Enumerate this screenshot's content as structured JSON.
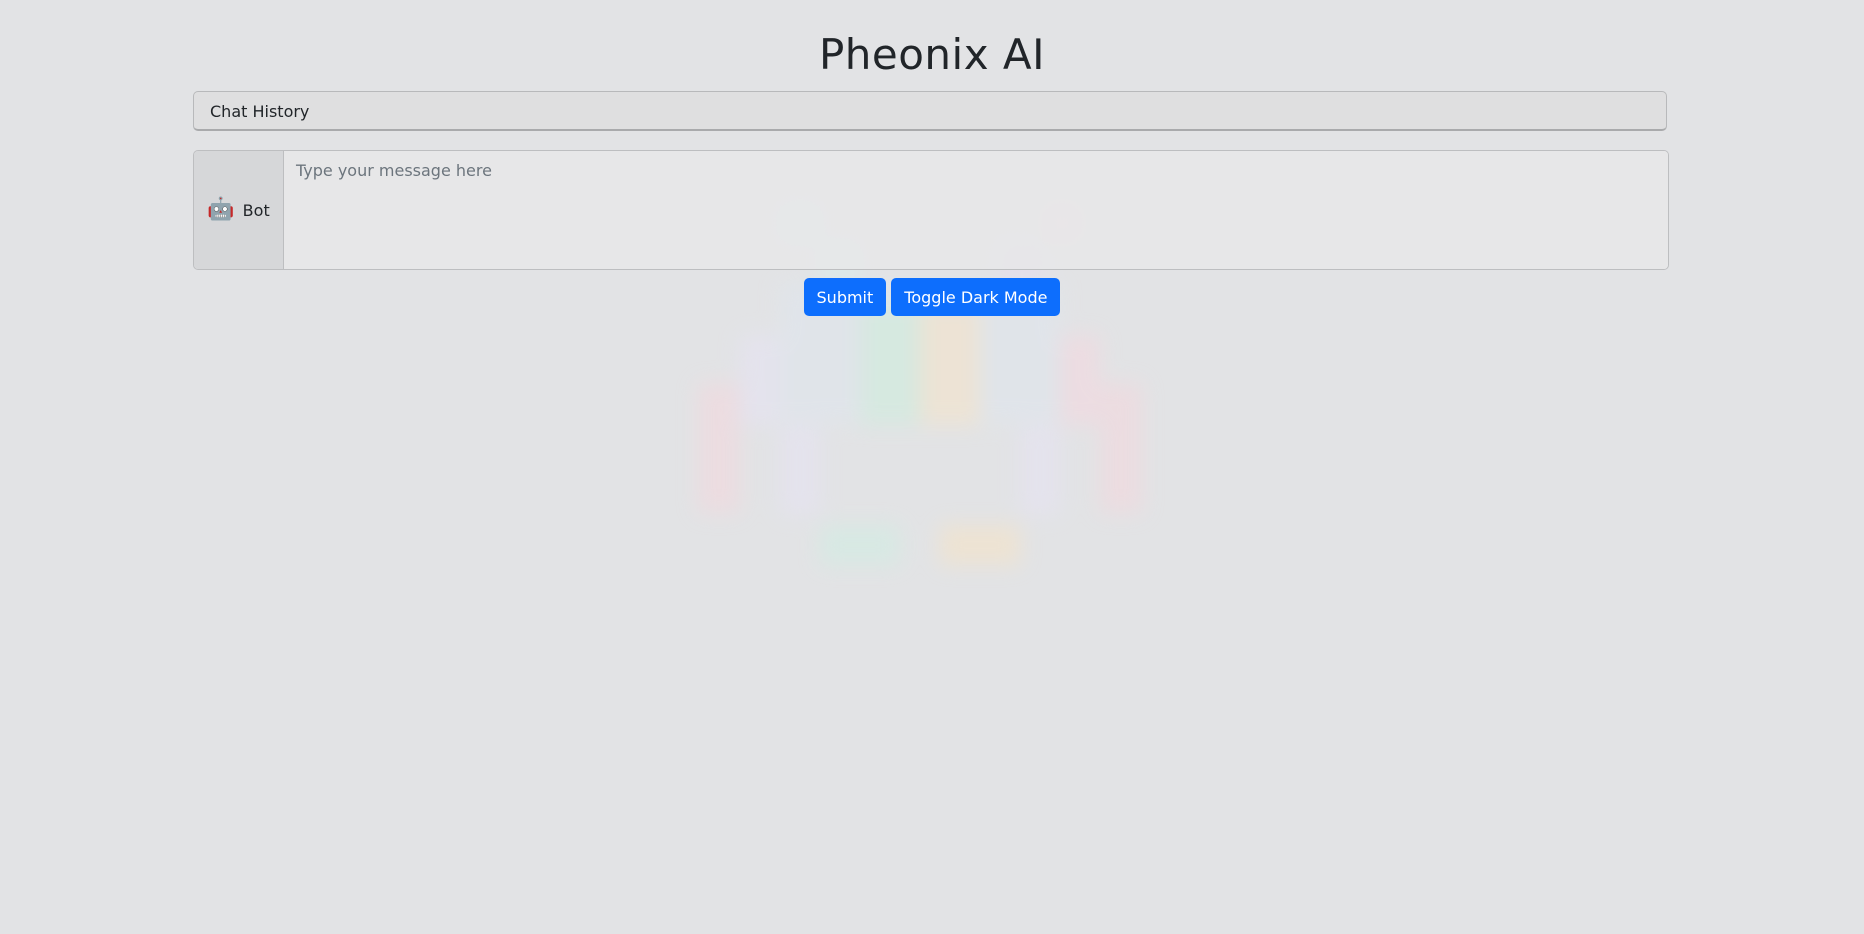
{
  "app": {
    "title": "Pheonix AI"
  },
  "chat_history": {
    "label": "Chat History"
  },
  "composer": {
    "bot_icon": "robot-emoji",
    "bot_emoji": "🤖",
    "bot_label": "Bot",
    "placeholder": "Type your message here",
    "value": ""
  },
  "actions": {
    "submit_label": "Submit",
    "toggle_dark_label": "Toggle Dark Mode"
  },
  "colors": {
    "background": "#e2e3e5",
    "primary_button": "#0d6efd",
    "text": "#212529"
  }
}
